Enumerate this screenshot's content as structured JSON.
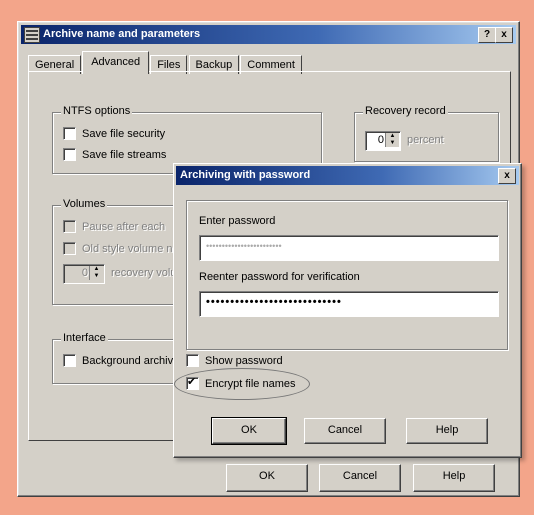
{
  "main_window": {
    "title": "Archive name and parameters",
    "help_btn": "?",
    "close_btn": "x",
    "tabs": [
      "General",
      "Advanced",
      "Files",
      "Backup",
      "Comment"
    ],
    "ntfs": {
      "label": "NTFS options",
      "save_security": "Save file security",
      "save_streams": "Save file streams"
    },
    "recovery": {
      "label": "Recovery record",
      "value": "0",
      "unit": "percent"
    },
    "volumes": {
      "label": "Volumes",
      "pause": "Pause after each",
      "old_style": "Old style volume names",
      "recovery_value": "0",
      "recovery_label": "recovery volumes"
    },
    "interface": {
      "label": "Interface",
      "background": "Background archiving"
    },
    "buttons": {
      "ok": "OK",
      "cancel": "Cancel",
      "help": "Help"
    }
  },
  "password_dialog": {
    "title": "Archiving with password",
    "close_btn": "x",
    "enter_label": "Enter password",
    "enter_value": "••••••••••••••••••••••••",
    "reenter_label": "Reenter password for verification",
    "reenter_value": "••••••••••••••••••••••••••••",
    "show_password": "Show password",
    "show_password_checked": false,
    "encrypt_names": "Encrypt file names",
    "encrypt_names_checked": true,
    "buttons": {
      "ok": "OK",
      "cancel": "Cancel",
      "help": "Help"
    }
  }
}
